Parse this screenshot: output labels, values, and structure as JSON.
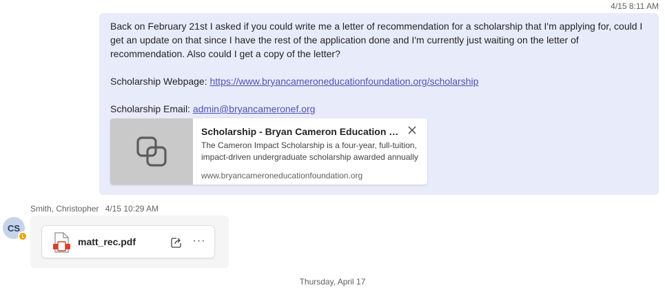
{
  "message_sent": {
    "timestamp": "4/15 8:11 AM",
    "paragraph1": "Back on February 21st I asked if you could write me a letter of recommendation for a scholarship that I'm applying for, could I get an update on that since I have the rest of the application done and I'm currently just waiting on the letter of recommendation. Also could I get a copy of the letter?",
    "webpage_label": "Scholarship Webpage: ",
    "webpage_link": "https://www.bryancameroneducationfoundation.org/scholarship",
    "email_label": "Scholarship Email: ",
    "email_link": "admin@bryancameronef.org",
    "link_preview": {
      "title": "Scholarship - Bryan Cameron Education Foundation",
      "description_line1": "The Cameron Impact Scholarship is a four-year, full-tuition,",
      "description_line2": "impact-driven undergraduate scholarship awarded annually",
      "domain": "www.bryancameroneducationfoundation.org",
      "thumbnail_icon": "link-icon",
      "close_icon": "close-icon"
    }
  },
  "reply": {
    "sender": "Smith, Christopher",
    "timestamp": "4/15 10:29 AM",
    "avatar_initials": "CS",
    "presence": "away",
    "attachment": {
      "file_name": "matt_rec.pdf",
      "file_icon": "pdf-file-icon",
      "share_icon": "share-icon",
      "more_label": "···"
    }
  },
  "date_divider": "Thursday, April 17",
  "colors": {
    "bubble_bg": "#e8ebfa",
    "link": "#4f52b2",
    "presence_away": "#eaa300",
    "pdf_red": "#d93f2a"
  }
}
